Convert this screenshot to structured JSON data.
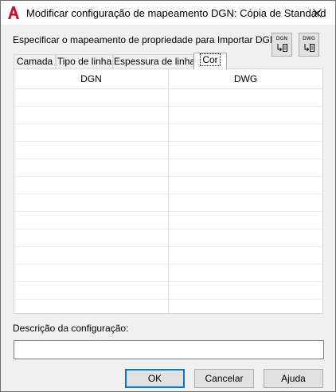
{
  "window": {
    "title": "Modificar configuração de mapeamento DGN: Cópia de Standard"
  },
  "instruction": "Especificar o mapeamento de propriedade para Importar DGN",
  "map_buttons": [
    {
      "label": "DGN",
      "icon": "map-from-dgn-icon"
    },
    {
      "label": "DWG",
      "icon": "map-from-dwg-icon"
    }
  ],
  "tabs": [
    {
      "label": "Camada",
      "active": false
    },
    {
      "label": "Tipo de linha",
      "active": false
    },
    {
      "label": "Espessura de linha",
      "active": false
    },
    {
      "label": "Cor",
      "active": true
    }
  ],
  "table": {
    "columns": [
      "DGN",
      "DWG"
    ],
    "rows": []
  },
  "description": {
    "label": "Descrição da configuração:",
    "value": ""
  },
  "buttons": {
    "ok": "OK",
    "cancel": "Cancelar",
    "help": "Ajuda"
  },
  "colors": {
    "accent": "#0078d7",
    "app_icon": "#c8102e"
  }
}
